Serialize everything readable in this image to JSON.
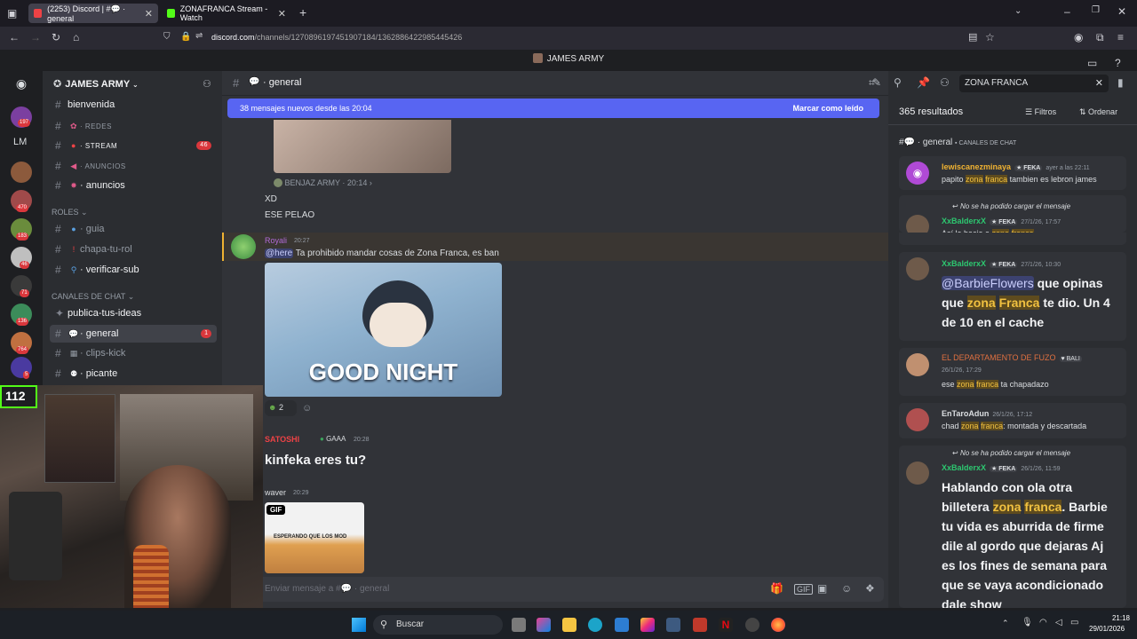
{
  "browser": {
    "tabs": [
      {
        "title": "(2253) Discord | #💬 · general",
        "active": true
      },
      {
        "title": "ZONAFRANCA Stream - Watch",
        "active": false
      }
    ],
    "new_tab": "+",
    "url_host": "discord.com",
    "url_path": "/channels/1270896197451907184/1362886422985445426"
  },
  "window_title": "JAMES ARMY",
  "guilds": {
    "badges": [
      "197",
      "470",
      "183",
      "46",
      "71",
      "136",
      "764",
      "5"
    ],
    "lm_label": "LM",
    "live_count": "112"
  },
  "sidebar": {
    "server_name": "JAMES ARMY",
    "channels": [
      {
        "name": "bienvenida",
        "prefix": "#"
      },
      {
        "name": "· REDES",
        "prefix": "#"
      },
      {
        "name": "· STREAM",
        "prefix": "#",
        "badge": "46"
      },
      {
        "name": "· ANUNCIOS",
        "prefix": "#"
      },
      {
        "name": "· anuncios",
        "prefix": "#"
      },
      {
        "name": "· guia",
        "prefix": "#"
      },
      {
        "name": "chapa-tu-rol",
        "prefix": "#"
      },
      {
        "name": "· verificar-sub",
        "prefix": "#"
      },
      {
        "name": "publica-tus-ideas",
        "prefix": ""
      },
      {
        "name": "· general",
        "prefix": "#",
        "badge": "1"
      },
      {
        "name": "· clips-kick",
        "prefix": "#"
      },
      {
        "name": "· picante",
        "prefix": "#"
      }
    ],
    "categories": [
      "ROLES",
      "CANALES DE CHAT"
    ]
  },
  "chat": {
    "channel": "general",
    "new_messages": "38 mensajes nuevos desde las 20:04",
    "mark_read": "Marcar como leído",
    "reply_author": "BENJAZ ARMY",
    "reply_time": "20:14",
    "messages": [
      {
        "text1": "XD",
        "text2": "ESE PELAO"
      },
      {
        "author": "Royali",
        "time": "20:27",
        "mention": "@here",
        "text": "Ta prohibido mandar cosas de Zona Franca, es ban",
        "image_caption": "GOOD NIGHT",
        "reaction_count": "2"
      },
      {
        "author": "SATOSHI",
        "tag": "GAAA",
        "time": "20:28",
        "text": "kinfeka eres tu?"
      },
      {
        "author": "waver",
        "time": "20:29",
        "gif_label": "GIF",
        "gif_caption": "ESPERANDO QUE LOS MOD"
      }
    ],
    "input_placeholder": "Enviar mensaje a #💬 · general"
  },
  "search": {
    "query": "ZONA FRANCA",
    "count": "365 resultados",
    "filters": "Filtros",
    "sort": "Ordenar",
    "channel_header": "· general",
    "channel_category": "CANALES DE CHAT",
    "load_fail": "No se ha podido cargar el mensaje",
    "results": [
      {
        "author": "lewiscanezminaya",
        "tag": "FEKA",
        "date": "ayer a las 22:11",
        "pre": "papito ",
        "hl1": "zona",
        "mid": " ",
        "hl2": "franca",
        "post": " tambien es lebron james"
      },
      {
        "author": "XxBalderxX",
        "tag": "FEKA",
        "date": "27/1/26, 17:57",
        "pre": "Así le hacia a ",
        "hl1": "zona",
        "mid": " ",
        "hl2": "franca",
        "post": ""
      },
      {
        "author": "XxBalderxX",
        "tag": "FEKA",
        "date": "27/1/26, 10:30",
        "mention": "@BarbieFlowers",
        "pre": " que opinas que ",
        "hl1": "zona",
        "mid": " ",
        "hl2": "Franca",
        "post": " te dio. Un 4 de 10 en el cache"
      },
      {
        "author": "EL DEPARTAMENTO DE FUZO",
        "tag": "BALI",
        "date": "26/1/26, 17:29",
        "pre": "ese ",
        "hl1": "zona",
        "mid": " ",
        "hl2": "franca",
        "post": " ta chapadazo"
      },
      {
        "author": "EnTaroAdun",
        "date": "26/1/26, 17:12",
        "pre": "chad ",
        "hl1": "zona",
        "mid": " ",
        "hl2": "franca",
        "post": ": montada y descartada"
      },
      {
        "author": "XxBalderxX",
        "tag": "FEKA",
        "date": "26/1/26, 11:59",
        "pre": "Hablando con ola otra billetera ",
        "hl1": "zona",
        "mid": " ",
        "hl2": "franca",
        "post": ". Barbie tu vida es aburrida de firme dile al gordo que dejaras Aj es los fines de semana para que se vaya acondicionado dale show"
      }
    ]
  },
  "taskbar": {
    "search_placeholder": "Buscar",
    "time": "21:18",
    "date": "29/01/2026"
  },
  "colors": {
    "blurple": "#5865f2",
    "highlight": "#f0c040",
    "danger": "#da373c"
  }
}
